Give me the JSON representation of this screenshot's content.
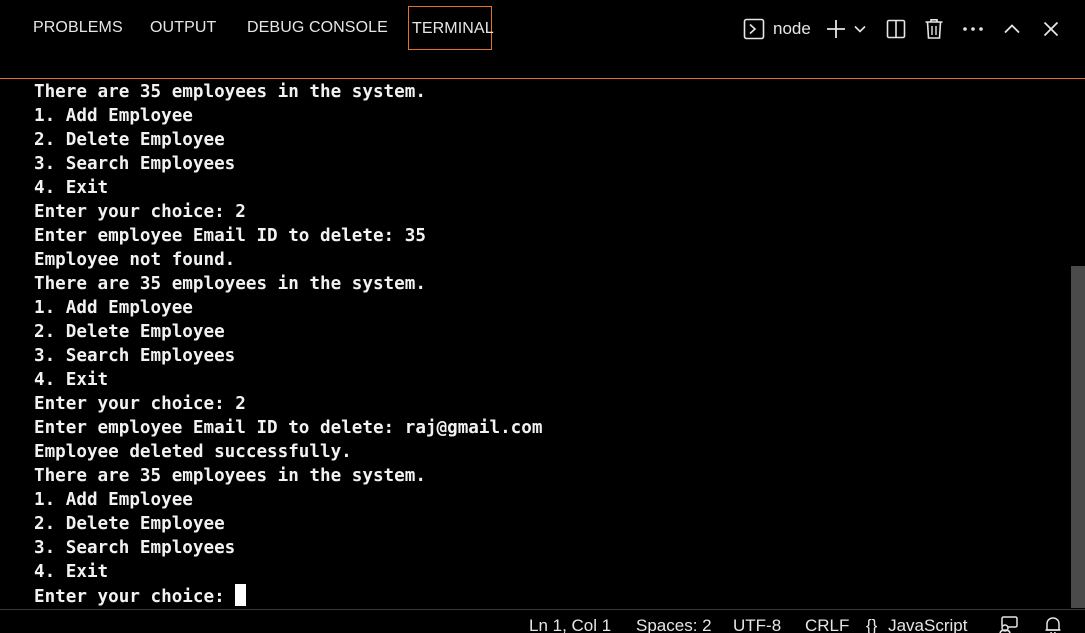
{
  "tabs": [
    {
      "label": "PROBLEMS",
      "active": false
    },
    {
      "label": "OUTPUT",
      "active": false
    },
    {
      "label": "DEBUG CONSOLE",
      "active": false
    },
    {
      "label": "TERMINAL",
      "active": true
    }
  ],
  "terminal_toolbar": {
    "shell_name": "node",
    "icons": [
      "terminal-icon",
      "plus-icon",
      "chevron-down-icon",
      "split-icon",
      "trash-icon",
      "more-icon",
      "chevron-up-icon",
      "close-icon"
    ]
  },
  "terminal_lines": [
    "There are 35 employees in the system.",
    "1. Add Employee",
    "2. Delete Employee",
    "3. Search Employees",
    "4. Exit",
    "Enter your choice: 2",
    "Enter employee Email ID to delete: 35",
    "Employee not found.",
    "There are 35 employees in the system.",
    "1. Add Employee",
    "2. Delete Employee",
    "3. Search Employees",
    "4. Exit",
    "Enter your choice: 2",
    "Enter employee Email ID to delete: raj@gmail.com",
    "Employee deleted successfully.",
    "There are 35 employees in the system.",
    "1. Add Employee",
    "2. Delete Employee",
    "3. Search Employees",
    "4. Exit"
  ],
  "prompt_line": "Enter your choice: ",
  "statusbar": {
    "position": "Ln 1, Col 1",
    "spaces": "Spaces: 2",
    "encoding": "UTF-8",
    "eol": "CRLF",
    "language_icon": "{}",
    "language": "JavaScript"
  },
  "colors": {
    "background": "#000000",
    "accent": "#e0722c",
    "text": "#f2f2f2",
    "scrollbar": "#4a4a4a"
  }
}
